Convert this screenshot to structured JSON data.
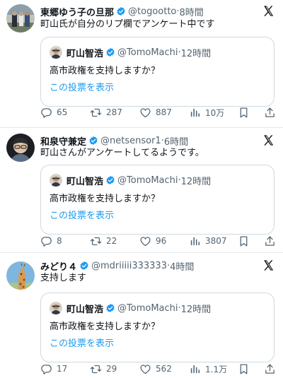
{
  "tweets": [
    {
      "name": "東郷ゆう子の旦那",
      "handle": "@togootto",
      "separator": "·",
      "time": "8時間",
      "text": "町山氏が自分のリプ欄でアンケート中です",
      "quote": {
        "name": "町山智浩",
        "handle": "@TomoMachi",
        "separator": "·",
        "time": "12時間",
        "text": "高市政権を支持しますか？",
        "link": "この投票を表示"
      },
      "stats": {
        "replies": "65",
        "reposts": "287",
        "likes": "887",
        "views": "10万"
      }
    },
    {
      "name": "和泉守兼定",
      "handle": "@netsensor1",
      "separator": "·",
      "time": "6時間",
      "text": "町山さんがアンケートしてるようです。",
      "quote": {
        "name": "町山智浩",
        "handle": "@TomoMachi",
        "separator": "·",
        "time": "12時間",
        "text": "高市政権を支持しますか？",
        "link": "この投票を表示"
      },
      "stats": {
        "replies": "8",
        "reposts": "22",
        "likes": "96",
        "views": "3807"
      }
    },
    {
      "name": "みどり４",
      "handle": "@mdriiiii333333",
      "separator": "·",
      "time": "4時間",
      "text": "支持します",
      "quote": {
        "name": "町山智浩",
        "handle": "@TomoMachi",
        "separator": "·",
        "time": "12時間",
        "text": "高市政権を支持しますか？",
        "link": "この投票を表示"
      },
      "stats": {
        "replies": "17",
        "reposts": "29",
        "likes": "562",
        "views": "1.1万"
      }
    }
  ],
  "icons": {
    "verified": "verified-badge-icon",
    "platform": "x-logo-icon",
    "reply": "reply-icon",
    "repost": "repost-icon",
    "like": "like-icon",
    "views": "views-icon",
    "bookmark": "bookmark-icon",
    "share": "share-icon"
  },
  "colors": {
    "verified": "#1d9bf0",
    "link": "#1d9bf0",
    "secondary": "#536471",
    "border": "#cfd9de"
  }
}
